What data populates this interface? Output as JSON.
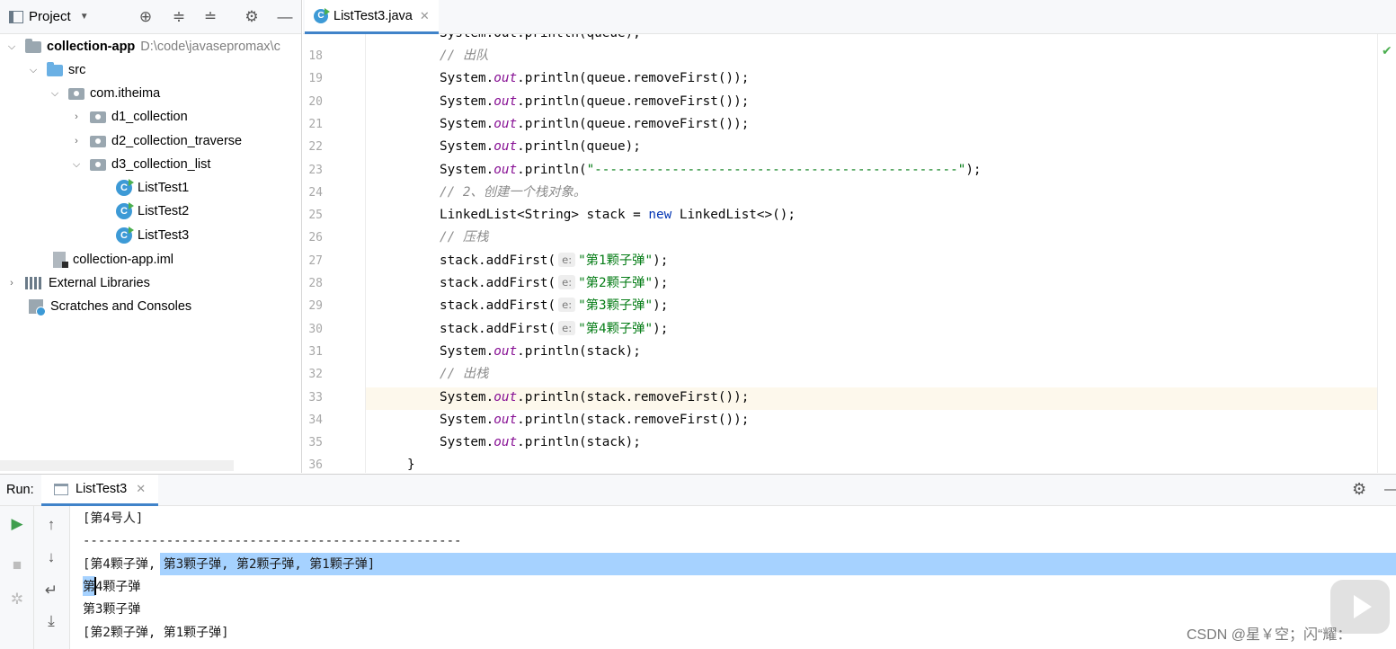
{
  "project": {
    "title": "Project",
    "root_name": "collection-app",
    "root_path": "D:\\code\\javasepromax\\c",
    "src": "src",
    "package": "com.itheima",
    "folders": [
      "d1_collection",
      "d2_collection_traverse",
      "d3_collection_list"
    ],
    "classes": [
      "ListTest1",
      "ListTest2",
      "ListTest3"
    ],
    "iml": "collection-app.iml",
    "external_libraries": "External Libraries",
    "scratches": "Scratches and Consoles"
  },
  "editor": {
    "tab_label": "ListTest3.java",
    "partial_top_line": "System.out.println(queue);",
    "lines": [
      {
        "n": "18",
        "parts": [
          {
            "t": "// 出队",
            "c": "cm"
          }
        ]
      },
      {
        "n": "19",
        "parts": [
          {
            "t": "System.",
            "c": ""
          },
          {
            "t": "out",
            "c": "fld"
          },
          {
            "t": ".println(queue.removeFirst());",
            "c": ""
          }
        ]
      },
      {
        "n": "20",
        "parts": [
          {
            "t": "System.",
            "c": ""
          },
          {
            "t": "out",
            "c": "fld"
          },
          {
            "t": ".println(queue.removeFirst());",
            "c": ""
          }
        ]
      },
      {
        "n": "21",
        "parts": [
          {
            "t": "System.",
            "c": ""
          },
          {
            "t": "out",
            "c": "fld"
          },
          {
            "t": ".println(queue.removeFirst());",
            "c": ""
          }
        ]
      },
      {
        "n": "22",
        "parts": [
          {
            "t": "System.",
            "c": ""
          },
          {
            "t": "out",
            "c": "fld"
          },
          {
            "t": ".println(queue);",
            "c": ""
          }
        ]
      },
      {
        "n": "23",
        "parts": [
          {
            "t": "System.",
            "c": ""
          },
          {
            "t": "out",
            "c": "fld"
          },
          {
            "t": ".println(",
            "c": ""
          },
          {
            "t": "\"-----------------------------------------------\"",
            "c": "str"
          },
          {
            "t": ");",
            "c": ""
          }
        ]
      },
      {
        "n": "24",
        "parts": [
          {
            "t": "// 2、创建一个栈对象。",
            "c": "cm"
          }
        ]
      },
      {
        "n": "25",
        "parts": [
          {
            "t": "LinkedList<String> stack = ",
            "c": ""
          },
          {
            "t": "new",
            "c": "kw"
          },
          {
            "t": " LinkedList<>();",
            "c": ""
          }
        ]
      },
      {
        "n": "26",
        "parts": [
          {
            "t": "// 压栈",
            "c": "cm"
          }
        ]
      },
      {
        "n": "27",
        "parts": [
          {
            "t": "stack.addFirst(",
            "c": ""
          },
          {
            "t": "e:",
            "c": "hint"
          },
          {
            "t": "\"第1颗子弹\"",
            "c": "str"
          },
          {
            "t": ");",
            "c": ""
          }
        ]
      },
      {
        "n": "28",
        "parts": [
          {
            "t": "stack.addFirst(",
            "c": ""
          },
          {
            "t": "e:",
            "c": "hint"
          },
          {
            "t": "\"第2颗子弹\"",
            "c": "str"
          },
          {
            "t": ");",
            "c": ""
          }
        ]
      },
      {
        "n": "29",
        "parts": [
          {
            "t": "stack.addFirst(",
            "c": ""
          },
          {
            "t": "e:",
            "c": "hint"
          },
          {
            "t": "\"第3颗子弹\"",
            "c": "str"
          },
          {
            "t": ");",
            "c": ""
          }
        ]
      },
      {
        "n": "30",
        "parts": [
          {
            "t": "stack.addFirst(",
            "c": ""
          },
          {
            "t": "e:",
            "c": "hint"
          },
          {
            "t": "\"第4颗子弹\"",
            "c": "str"
          },
          {
            "t": ");",
            "c": ""
          }
        ]
      },
      {
        "n": "31",
        "parts": [
          {
            "t": "System.",
            "c": ""
          },
          {
            "t": "out",
            "c": "fld"
          },
          {
            "t": ".println(stack);",
            "c": ""
          }
        ]
      },
      {
        "n": "32",
        "parts": [
          {
            "t": "// 出栈",
            "c": "cm"
          }
        ]
      },
      {
        "n": "33",
        "parts": [
          {
            "t": "System.",
            "c": ""
          },
          {
            "t": "out",
            "c": "fld"
          },
          {
            "t": ".println(stack.removeFirst());",
            "c": ""
          }
        ]
      },
      {
        "n": "34",
        "parts": [
          {
            "t": "System.",
            "c": ""
          },
          {
            "t": "out",
            "c": "fld"
          },
          {
            "t": ".println(stack.removeFirst());",
            "c": ""
          }
        ]
      },
      {
        "n": "35",
        "parts": [
          {
            "t": "System.",
            "c": ""
          },
          {
            "t": "out",
            "c": "fld"
          },
          {
            "t": ".println(stack);",
            "c": ""
          }
        ]
      },
      {
        "n": "36",
        "parts": [
          {
            "t": "}",
            "c": ""
          }
        ]
      }
    ],
    "highlighted_line": "33"
  },
  "run": {
    "label": "Run:",
    "tab_label": "ListTest3",
    "output": [
      "[第4号人]",
      "--------------------------------------------------",
      "[第4颗子弹, 第3颗子弹, 第2颗子弹, 第1颗子弹]",
      "第4颗子弹",
      "第3颗子弹",
      "[第2颗子弹, 第1颗子弹]"
    ]
  },
  "watermark": "CSDN @星￥空；闪“耀：",
  "colors": {
    "accent": "#4083c9",
    "selection": "#a6d2ff",
    "current_line": "#fdf8ec",
    "string": "#067d17",
    "keyword": "#0033b3",
    "comment": "#8c8c8c",
    "field": "#871094"
  }
}
